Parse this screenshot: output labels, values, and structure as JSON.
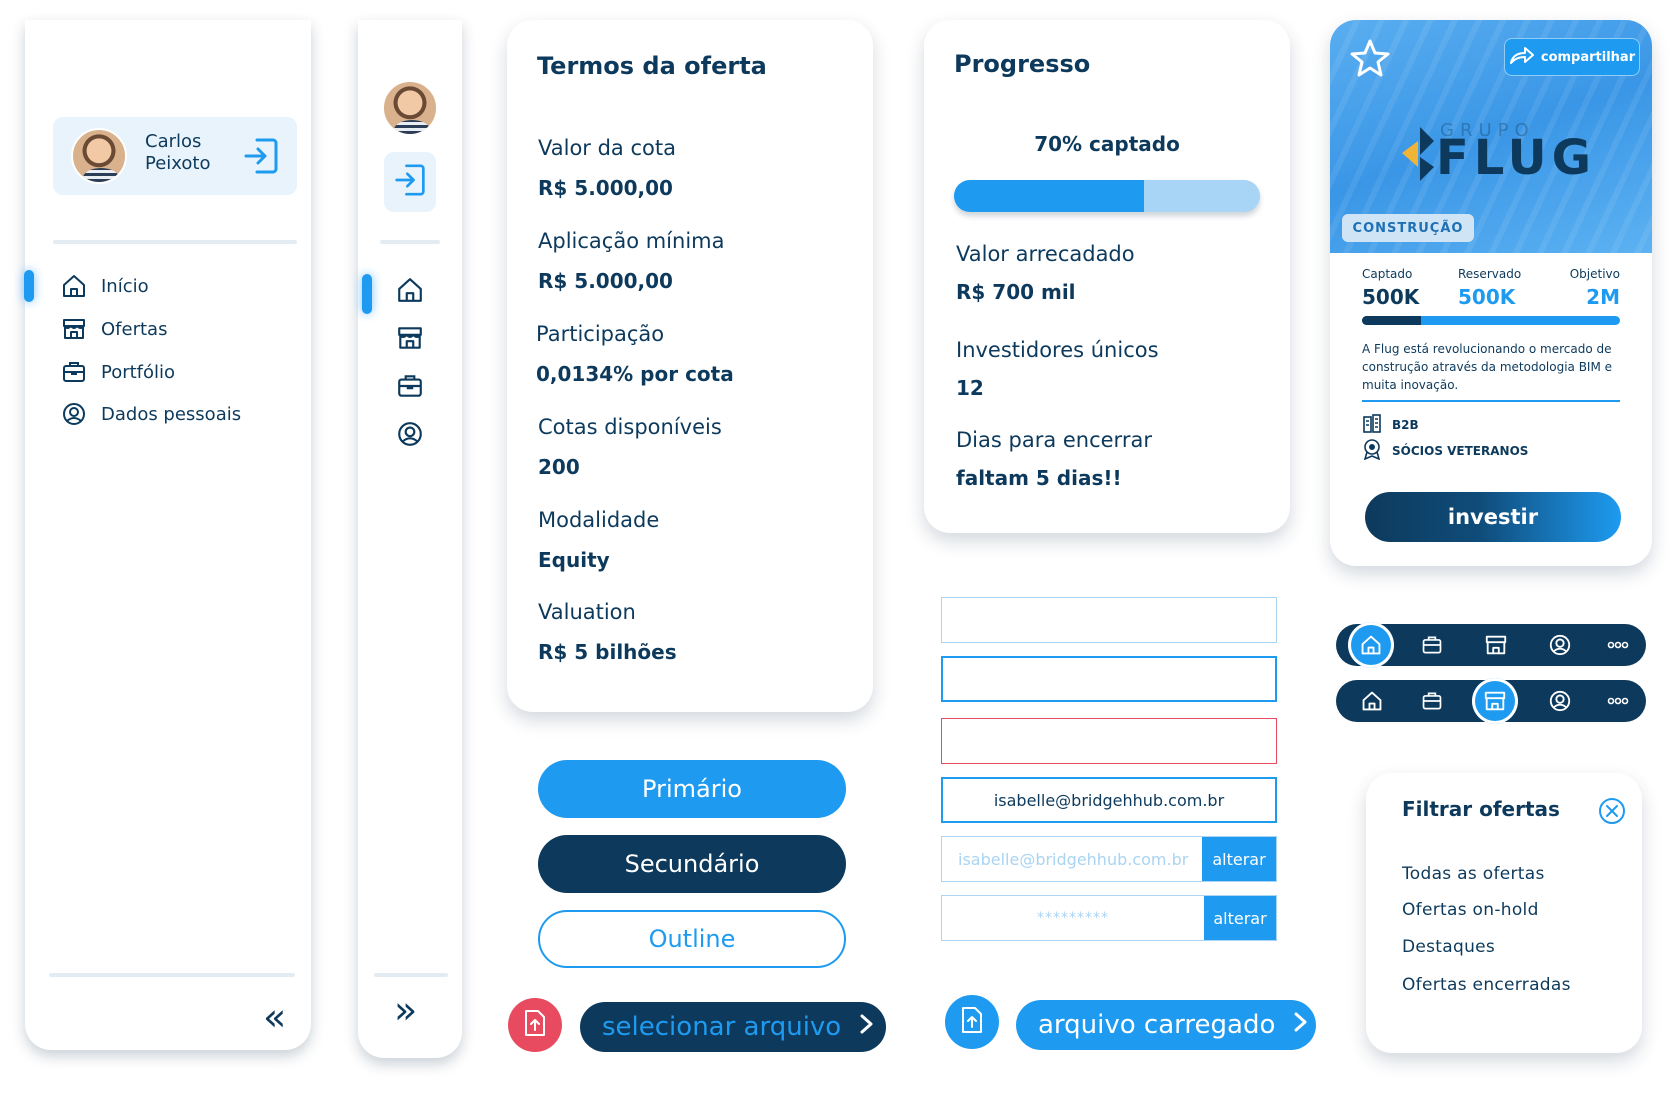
{
  "sidebar": {
    "user_name": "Carlos Peixoto",
    "items": [
      {
        "label": "Início",
        "icon": "home-icon"
      },
      {
        "label": "Ofertas",
        "icon": "store-icon"
      },
      {
        "label": "Portfólio",
        "icon": "briefcase-icon"
      },
      {
        "label": "Dados pessoais",
        "icon": "user-circle-icon"
      }
    ],
    "collapse_label": "«",
    "expand_label": "»"
  },
  "terms": {
    "title": "Termos da oferta",
    "rows": [
      {
        "label": "Valor da cota",
        "value": "R$ 5.000,00"
      },
      {
        "label": "Aplicação mínima",
        "value": "R$ 5.000,00"
      },
      {
        "label": "Participação",
        "value": "0,0134% por cota"
      },
      {
        "label": "Cotas disponíveis",
        "value": "200"
      },
      {
        "label": "Modalidade",
        "value": "Equity"
      },
      {
        "label": "Valuation",
        "value": "R$ 5 bilhões"
      }
    ]
  },
  "progress": {
    "title": "Progresso",
    "caption": "70% captado",
    "fraction": 0.62,
    "rows": [
      {
        "label": "Valor arrecadado",
        "value": "R$ 700 mil"
      },
      {
        "label": "Investidores únicos",
        "value": "12"
      },
      {
        "label": "Dias para encerrar",
        "value": "faltam 5 dias!!"
      }
    ]
  },
  "buttons": {
    "primary": "Primário",
    "secondary": "Secundário",
    "outline": "Outline",
    "select_file": "selecionar arquivo",
    "file_uploaded": "arquivo carregado"
  },
  "inputs": {
    "email_value": "isabelle@bridgehhub.com.br",
    "email_readonly": "isabelle@bridgehhub.com.br",
    "password_mask": "*********",
    "change_label": "alterar"
  },
  "offer": {
    "share_label": "compartilhar",
    "brand_small": "GRUPO",
    "brand_big": "FLUG",
    "category": "CONSTRUÇÃO",
    "stats": [
      {
        "label": "Captado",
        "value": "500K"
      },
      {
        "label": "Reservado",
        "value": "500K"
      },
      {
        "label": "Objetivo",
        "value": "2M"
      }
    ],
    "description": "A Flug está revolucionando o mercado de construção através da metodologia BIM e muita inovação.",
    "tags": [
      {
        "label": "B2B",
        "icon": "buildings-icon"
      },
      {
        "label": "SÓCIOS VETERANOS",
        "icon": "award-icon"
      }
    ],
    "invest_label": "investir",
    "captado_fraction": 0.23,
    "reservado_fraction": 0.23
  },
  "filter": {
    "title": "Filtrar ofertas",
    "items": [
      "Todas as ofertas",
      "Ofertas on-hold",
      "Destaques",
      "Ofertas encerradas"
    ]
  },
  "colors": {
    "navy": "#0d3a5c",
    "blue": "#1e9bf0",
    "light_blue": "#a8d4f5",
    "error": "#e84a5f"
  }
}
